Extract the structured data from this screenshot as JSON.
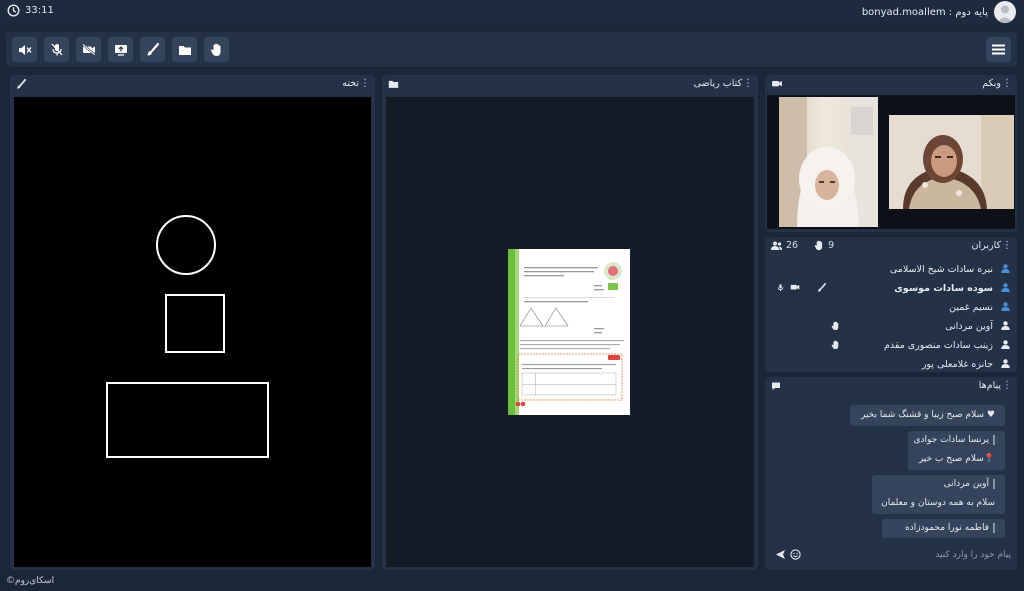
{
  "topbar": {
    "timer": "33:11",
    "user_label": "bonyad.moallem : پایه دوم"
  },
  "toolbar": {
    "buttons": [
      "speaker-off",
      "mic-off",
      "camera-off",
      "share-screen",
      "draw",
      "files",
      "raise-hand"
    ],
    "menu_icon": "hamburger-icon"
  },
  "whiteboard": {
    "title": "تخته",
    "shapes": [
      "circle",
      "square",
      "rectangle"
    ]
  },
  "book": {
    "title": "کتاب ریاضی"
  },
  "webcam": {
    "title": "وبکم"
  },
  "users": {
    "title": "کاربران",
    "count": "26",
    "hands": "9",
    "list": [
      {
        "name": "نیره سادات شیخ الاسلامی",
        "bold": false,
        "icon_color": "#4a90d9"
      },
      {
        "name": "سوده سادات موسوی",
        "bold": true,
        "icon_color": "#4a90d9"
      },
      {
        "name": "نسیم غمین",
        "bold": false,
        "icon_color": "#4a90d9"
      },
      {
        "name": "آوین مردانی",
        "bold": false,
        "icon_color": "#e6ebf2"
      },
      {
        "name": "زینب سادات منصوری مقدم",
        "bold": false,
        "icon_color": "#e6ebf2"
      },
      {
        "name": "جانزه غلامعلی پور",
        "bold": false,
        "icon_color": "#e6ebf2"
      }
    ]
  },
  "messages": {
    "title": "پیام‌ها",
    "items": [
      {
        "sender": "",
        "text": "سلام صبح زیبا و قشنگ شما بخیر"
      },
      {
        "sender": "پرنسا سادات جوادی",
        "text": "سلام صبح ب خیر"
      },
      {
        "sender": "آوین مردانی",
        "text": "سلام به همه دوستان و معلمان"
      },
      {
        "sender": "فاطمه نورا محمودزاده",
        "text": ""
      }
    ],
    "input_placeholder": "پیام خود را وارد کنید"
  },
  "footer": {
    "brand": "©اسکای‌روم"
  },
  "colors": {
    "background": "#1b2638",
    "panel": "#243248",
    "button": "#34445c",
    "accent_blue": "#4a90d9"
  }
}
